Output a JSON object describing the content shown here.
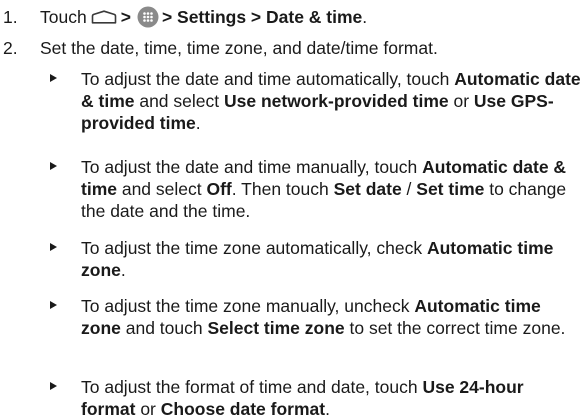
{
  "steps": [
    {
      "number": "1.",
      "prefix": "Touch",
      "sep1": ">",
      "path": "> Settings > Date & time",
      "period": "."
    },
    {
      "number": "2.",
      "text": "Set the date, time, time zone, and date/time format."
    }
  ],
  "bullets": [
    {
      "t1": "To adjust the date and time automatically, touch ",
      "b1": "Automatic date & time",
      "t2": " and select ",
      "b2": "Use network-provided time",
      "t3": " or ",
      "b3": "Use GPS-provided time",
      "t4": "."
    },
    {
      "t1": "To adjust the date and time manually, touch ",
      "b1": "Automatic date & time",
      "t2": " and select ",
      "b2": "Off",
      "t3": ". Then touch ",
      "b3": "Set date",
      "t4": " / ",
      "b4": "Set time",
      "t5": " to change the date and the time."
    },
    {
      "t1": "To adjust the time zone automatically, check ",
      "b1": "Automatic time zone",
      "t2": "."
    },
    {
      "t1": "To adjust the time zone manually, uncheck ",
      "b1": "Automatic time zone",
      "t2": " and touch ",
      "b2": "Select time zone",
      "t3": " to set the correct time zone."
    },
    {
      "t1": "To adjust the format of time and date, touch ",
      "b1": "Use 24-hour format",
      "t2": " or ",
      "b2": "Choose date format",
      "t3": "."
    }
  ],
  "icons": {
    "home": "home-icon",
    "apps": "all-apps-icon"
  },
  "colors": {
    "text": "#1a1a1a",
    "apps_icon_fill": "#8a8a8a"
  }
}
